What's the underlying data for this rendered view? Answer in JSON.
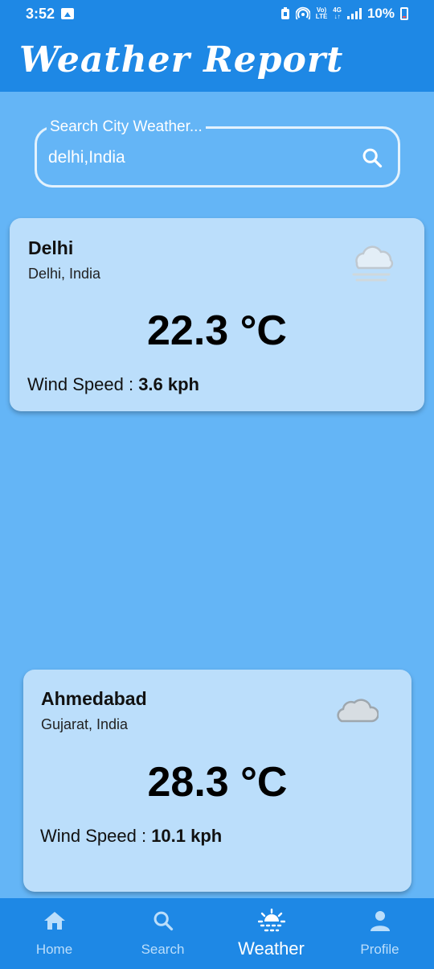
{
  "status_bar": {
    "time": "3:52",
    "network_top": "Vo)",
    "network_bottom": "LTE",
    "network_gen": "4G",
    "battery_percent": "10%"
  },
  "app_bar": {
    "title": "Weather Report"
  },
  "search": {
    "label": "Search City Weather...",
    "value": "delhi,India",
    "icon": "search-icon"
  },
  "cards": [
    {
      "city": "Delhi",
      "region": "Delhi, India",
      "temperature": "22.3 °C",
      "wind_label": "Wind Speed : ",
      "wind_value": "3.6 kph",
      "icon": "mist-cloud-icon"
    },
    {
      "city": "Ahmedabad",
      "region": "Gujarat, India",
      "temperature": "28.3 °C",
      "wind_label": "Wind Speed : ",
      "wind_value": "10.1 kph",
      "icon": "cloud-icon"
    }
  ],
  "bottom_nav": {
    "items": [
      {
        "label": "Home",
        "icon": "home-icon"
      },
      {
        "label": "Search",
        "icon": "search-icon"
      },
      {
        "label": "Weather",
        "icon": "sun-icon",
        "active": true
      },
      {
        "label": "Profile",
        "icon": "person-icon"
      }
    ]
  },
  "colors": {
    "primary": "#1e88e5",
    "background": "#64b5f6",
    "card": "#bbdefb",
    "nav_inactive": "#bbdefb"
  }
}
